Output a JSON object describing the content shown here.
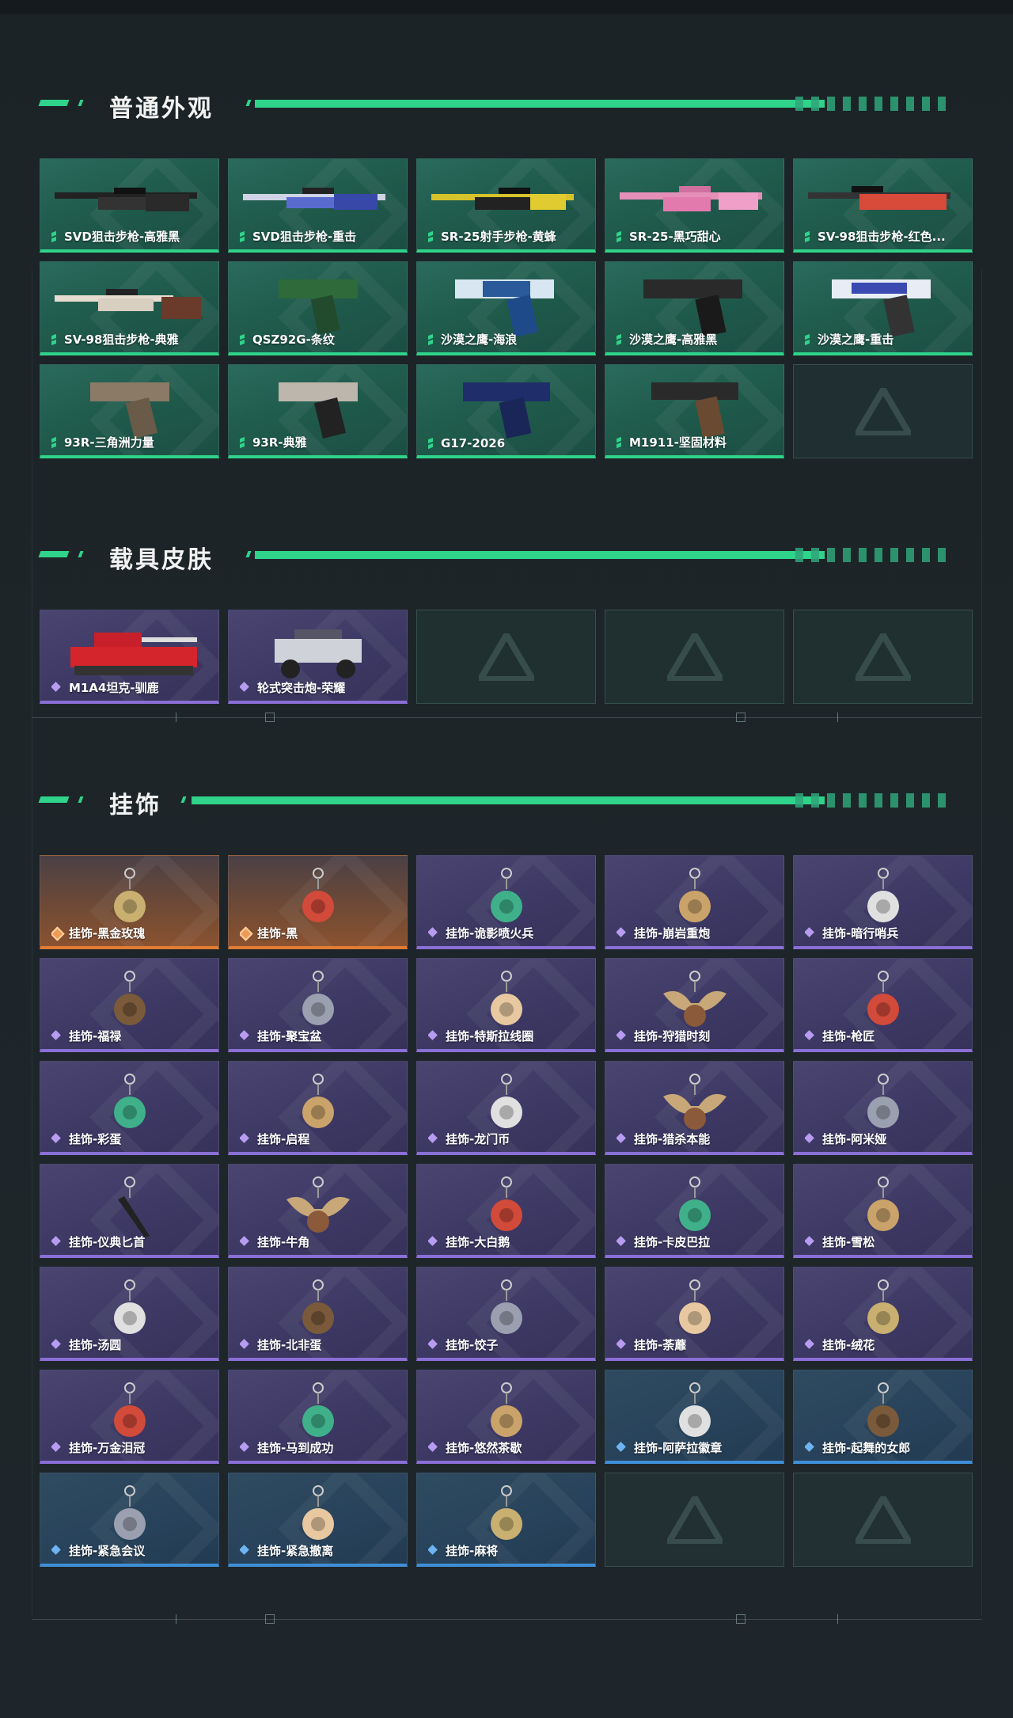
{
  "sections": [
    {
      "title": "普通外观",
      "items": [
        {
          "label": "SVD狙击步枪-高雅黑",
          "icon": "rifle-icon"
        },
        {
          "label": "SVD狙击步枪-重击",
          "icon": "rifle-icon"
        },
        {
          "label": "SR-25射手步枪-黄蜂",
          "icon": "rifle-icon"
        },
        {
          "label": "SR-25-黑巧甜心",
          "icon": "rifle-icon"
        },
        {
          "label": "SV-98狙击步枪-红色...",
          "icon": "rifle-icon"
        },
        {
          "label": "SV-98狙击步枪-典雅",
          "icon": "rifle-icon"
        },
        {
          "label": "QSZ92G-条纹",
          "icon": "pistol-icon"
        },
        {
          "label": "沙漠之鹰-海浪",
          "icon": "pistol-icon"
        },
        {
          "label": "沙漠之鹰-高雅黑",
          "icon": "pistol-icon"
        },
        {
          "label": "沙漠之鹰-重击",
          "icon": "pistol-icon"
        },
        {
          "label": "93R-三角洲力量",
          "icon": "pistol-icon"
        },
        {
          "label": "93R-典雅",
          "icon": "pistol-icon"
        },
        {
          "label": "G17-2026",
          "icon": "pistol-icon"
        },
        {
          "label": "M1911-坚固材料",
          "icon": "pistol-icon"
        }
      ]
    },
    {
      "title": "载具皮肤",
      "items": [
        {
          "label": "M1A4坦克-驯鹿",
          "icon": "tank-icon"
        },
        {
          "label": "轮式突击炮-荣耀",
          "icon": "armored-car-icon"
        }
      ]
    },
    {
      "title": "挂饰",
      "items": [
        {
          "label": "挂饰-黑金玫瑰",
          "icon": "charm-icon"
        },
        {
          "label": "挂饰-黑",
          "icon": "charm-icon"
        },
        {
          "label": "挂饰-诡影喷火兵",
          "icon": "charm-icon"
        },
        {
          "label": "挂饰-崩岩重炮",
          "icon": "charm-icon"
        },
        {
          "label": "挂饰-暗行哨兵",
          "icon": "charm-icon"
        },
        {
          "label": "挂饰-福禄",
          "icon": "charm-icon"
        },
        {
          "label": "挂饰-聚宝盆",
          "icon": "charm-icon"
        },
        {
          "label": "挂饰-特斯拉线圈",
          "icon": "charm-icon"
        },
        {
          "label": "挂饰-狩猎时刻",
          "icon": "antler-charm-icon"
        },
        {
          "label": "挂饰-枪匠",
          "icon": "charm-icon"
        },
        {
          "label": "挂饰-彩蛋",
          "icon": "charm-icon"
        },
        {
          "label": "挂饰-启程",
          "icon": "charm-icon"
        },
        {
          "label": "挂饰-龙门币",
          "icon": "charm-icon"
        },
        {
          "label": "挂饰-猎杀本能",
          "icon": "antler-charm-icon"
        },
        {
          "label": "挂饰-阿米娅",
          "icon": "charm-icon"
        },
        {
          "label": "挂饰-仪典匕首",
          "icon": "dagger-charm-icon"
        },
        {
          "label": "挂饰-牛角",
          "icon": "horn-charm-icon"
        },
        {
          "label": "挂饰-大白鹅",
          "icon": "charm-icon"
        },
        {
          "label": "挂饰-卡皮巴拉",
          "icon": "charm-icon"
        },
        {
          "label": "挂饰-雪松",
          "icon": "charm-icon"
        },
        {
          "label": "挂饰-汤圆",
          "icon": "charm-icon"
        },
        {
          "label": "挂饰-北非蛋",
          "icon": "charm-icon"
        },
        {
          "label": "挂饰-饺子",
          "icon": "charm-icon"
        },
        {
          "label": "挂饰-荼蘼",
          "icon": "charm-icon"
        },
        {
          "label": "挂饰-绒花",
          "icon": "charm-icon"
        },
        {
          "label": "挂饰-万金泪冠",
          "icon": "charm-icon"
        },
        {
          "label": "挂饰-马到成功",
          "icon": "charm-icon"
        },
        {
          "label": "挂饰-悠然茶歇",
          "icon": "charm-icon"
        },
        {
          "label": "挂饰-阿萨拉徽章",
          "icon": "charm-icon"
        },
        {
          "label": "挂饰-起舞的女郎",
          "icon": "charm-icon"
        },
        {
          "label": "挂饰-紧急会议",
          "icon": "charm-icon"
        },
        {
          "label": "挂饰-紧急撤离",
          "icon": "charm-icon"
        },
        {
          "label": "挂饰-麻将",
          "icon": "charm-icon"
        }
      ]
    }
  ],
  "colors": {
    "accent_green": "#2fd38a",
    "rarity_green": "#1f5a4b",
    "rarity_purple": "#3c3863",
    "rarity_orange": "#8a5230",
    "rarity_blue": "#27425a"
  }
}
